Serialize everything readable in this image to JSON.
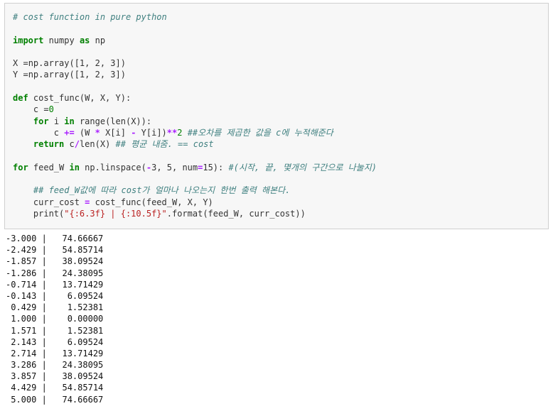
{
  "code": {
    "comment_header": "# cost function in pure python",
    "kw_import": "import",
    "mod_numpy": " numpy ",
    "kw_as": "as",
    "alias_np": " np",
    "x_assign": "X =",
    "y_assign": "Y =",
    "array_call": "np.array([1, 2, 3])",
    "kw_def": "def",
    "def_sig": " cost_func(W, X, Y):",
    "c_init_left": "    c =",
    "c_init_val": "0",
    "kw_for": "for",
    "for_i_var": " i ",
    "kw_in": "in",
    "range_text": " range(len(X)):",
    "accum_left": "        c ",
    "accum_op": "+=",
    "accum_expr_a": " (W ",
    "op_mul": "*",
    "accum_expr_b": " X[i] ",
    "op_minus": "-",
    "accum_expr_c": " Y[i])",
    "op_pow": "**",
    "accum_two": "2",
    "comment_accum": " ##오차를 제곱한 값을 c에 누적해준다",
    "kw_return": "return",
    "return_a": " c",
    "op_div": "/",
    "return_b": "len(X) ",
    "comment_return": "## 평균 내줌. == cost",
    "for_feed_var": " feed_W ",
    "linspace_a": " np.linspace(",
    "linspace_minus": "-",
    "linspace_b": "3, 5, num",
    "op_eq": "=",
    "linspace_c": "15): ",
    "comment_linspace": "#(시작, 끝, 몇개의 구간으로 나눌지)",
    "comment_feed": "    ## feed_W값에 따라 cost가 얼마나 나오는지 한번 출력 해본다.",
    "curr_cost_left": "    curr_cost ",
    "curr_cost_right": " cost_func(feed_W, X, Y)",
    "print_a": "    print(",
    "print_str": "\"{:6.3f} | {:10.5f}\"",
    "print_b": ".format(feed_W, curr_cost))"
  },
  "output_lines": [
    "-3.000 |   74.66667",
    "-2.429 |   54.85714",
    "-1.857 |   38.09524",
    "-1.286 |   24.38095",
    "-0.714 |   13.71429",
    "-0.143 |    6.09524",
    " 0.429 |    1.52381",
    " 1.000 |    0.00000",
    " 1.571 |    1.52381",
    " 2.143 |    6.09524",
    " 2.714 |   13.71429",
    " 3.286 |   24.38095",
    " 3.857 |   38.09524",
    " 4.429 |   54.85714",
    " 5.000 |   74.66667"
  ],
  "colors": {
    "cell_background": "#f7f7f7",
    "comment": "#408080",
    "keyword": "#008000",
    "operator": "#aa22ff",
    "string": "#ba2121"
  }
}
